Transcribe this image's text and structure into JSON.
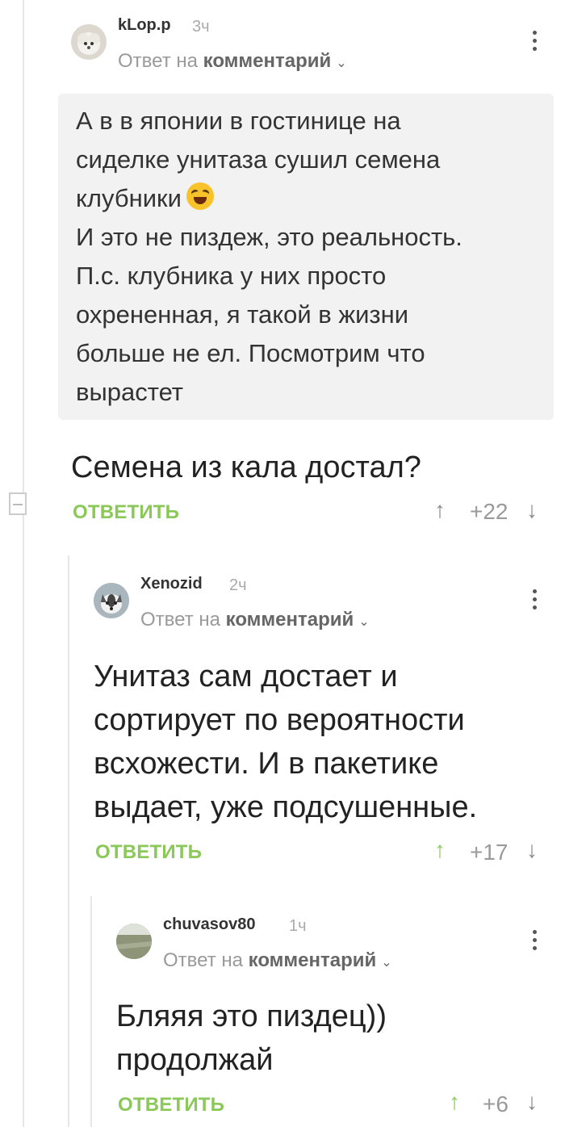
{
  "colors": {
    "accent": "#8ac858",
    "text": "#222222",
    "muted": "#9a9a9a",
    "quote_bg": "#f2f2f2"
  },
  "comment1": {
    "username": "kLop.p",
    "time": "3ч",
    "reply_prefix": "Ответ на",
    "reply_target": "комментарий",
    "quote_lines": [
      "А в в японии в гостинице на",
      "сиделке унитаза сушил семена",
      "клубники",
      "И это не пиздеж, это реальность.",
      "П.с. клубника у них просто",
      "охрененная, я такой в жизни",
      "больше не ел. Посмотрим что",
      "вырастет"
    ],
    "quote_emoji": "rolling-on-floor-laughing-emoji",
    "text_lines": [
      "Семена из кала достал?"
    ],
    "reply_label": "ОТВЕТИТЬ",
    "score": "+22"
  },
  "comment2": {
    "username": "Xenozid",
    "time": "2ч",
    "reply_prefix": "Ответ на",
    "reply_target": "комментарий",
    "text_lines": [
      "Унитаз сам достает и",
      "сортирует по вероятности",
      "всхожести. И в пакетике",
      "выдает, уже подсушенные."
    ],
    "reply_label": "ОТВЕТИТЬ",
    "score": "+17"
  },
  "comment3": {
    "username": "chuvasov80",
    "time": "1ч",
    "reply_prefix": "Ответ на",
    "reply_target": "комментарий",
    "text_lines": [
      "Бляяя это пиздец))",
      "продолжай"
    ],
    "reply_label": "ОТВЕТИТЬ",
    "score": "+6"
  }
}
